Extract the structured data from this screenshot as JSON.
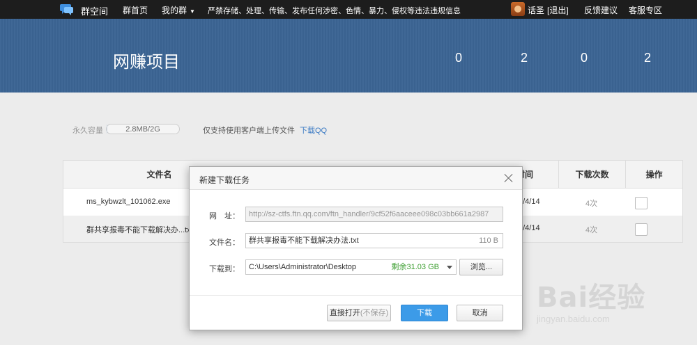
{
  "nav": {
    "brand": "群空间",
    "home": "群首页",
    "my_groups": "我的群",
    "notice": "严禁存储、处理、传输、发布任何涉密、色情、暴力、侵权等违法违规信息",
    "user": "话圣",
    "logout": "[退出]",
    "feedback": "反馈建议",
    "support": "客服专区"
  },
  "banner": {
    "title": "网赚项目",
    "stats": [
      "0",
      "2",
      "0",
      "2"
    ]
  },
  "storage": {
    "label": "永久容量",
    "usage": "2.8MB/2G",
    "used_fraction": 0.0014,
    "tip": "仅支持使用客户端上传文件",
    "link": "下载QQ"
  },
  "table": {
    "headers": {
      "name": "文件名",
      "time": "时间",
      "downloads": "下载次数",
      "action": "操作"
    },
    "rows": [
      {
        "name": "ms_kybwzlt_101062.exe",
        "date": "9/4/14",
        "count": "4次"
      },
      {
        "name": "群共享报毒不能下载解决办...tx",
        "date": "9/4/14",
        "count": "4次"
      }
    ]
  },
  "dialog": {
    "title": "新建下载任务",
    "url_label": "网　址：",
    "url_value": "http://sz-ctfs.ftn.qq.com/ftn_handler/9cf52f6aaceee098c03bb661a2987",
    "filename_label": "文件名：",
    "filename_value": "群共享报毒不能下载解决办法.txt",
    "file_size": "110 B",
    "saveto_label": "下载到：",
    "saveto_value": "C:\\Users\\Administrator\\Desktop",
    "free_space": "剩余31.03 GB",
    "browse": "浏览...",
    "open_direct": "直接打开",
    "open_direct_note": "(不保存)",
    "download": "下载",
    "cancel": "取消"
  },
  "watermark": {
    "text": "Bai经验",
    "url": "jingyan.baidu.com"
  }
}
